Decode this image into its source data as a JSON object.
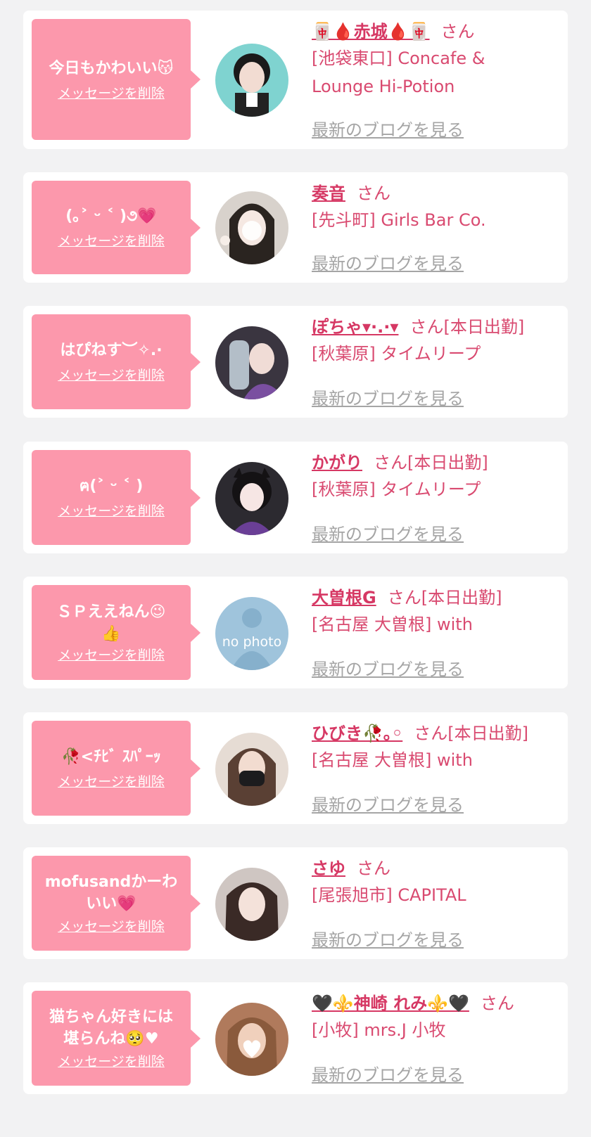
{
  "delete_label": "メッセージを削除",
  "san_label": "さん",
  "blog_label": "最新のブログを見る",
  "colors": {
    "background": "#f2f2f3",
    "bubble": "#fc98ac",
    "name": "#d63864",
    "text": "#d94a70",
    "blog_link": "#a5a5a5"
  },
  "entries": [
    {
      "message": "今日もかわいい😽",
      "name": "🀄🩸赤城🩸🀄",
      "shift": "",
      "shop": "[池袋東口] Concafe &\nLounge Hi-Potion"
    },
    {
      "message": "(｡˃ ᵕ ˂ )૭💗",
      "name": "奏音",
      "shift": "",
      "shop": "[先斗町] Girls Bar Co."
    },
    {
      "message": "はぴねす︶✧.·",
      "name": "ぽちゃ▾·.·▾",
      "shift": "[本日出勤]",
      "shop": "[秋葉原] タイムリープ"
    },
    {
      "message": "ฅ(˃ ᵕ ˂ )",
      "name": "かがり",
      "shift": "[本日出勤]",
      "shop": "[秋葉原] タイムリープ"
    },
    {
      "message": "ＳＰええねん😉\n👍",
      "name": "大曽根G",
      "shift": "[本日出勤]",
      "shop": "[名古屋 大曽根] with",
      "avatar_text": "no photo"
    },
    {
      "message": "🥀<ﾁﾋﾞ ｽﾊﾟｰｯ",
      "name": "ひびき🥀｡◦",
      "shift": "[本日出勤]",
      "shop": "[名古屋 大曽根] with"
    },
    {
      "message": "mofusandかーわ\nいい💗",
      "name": "さゆ",
      "shift": "",
      "shop": "[尾張旭市] CAPITAL"
    },
    {
      "message": "猫ちゃん好きには\n堪らんね🥺♥",
      "name": "🖤⚜️神崎 れみ⚜️🖤",
      "shift": "",
      "shop": "[小牧] mrs.J 小牧"
    }
  ]
}
